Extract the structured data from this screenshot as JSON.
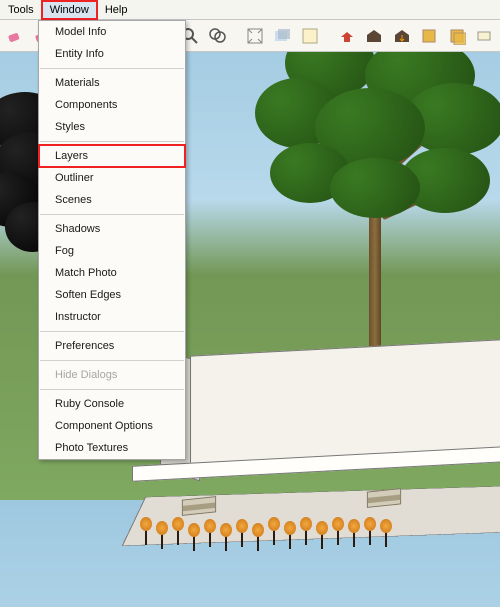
{
  "menubar": {
    "items": [
      "Tools",
      "Window",
      "Help"
    ],
    "highlighted_index": 1
  },
  "toolbar": {
    "tools": [
      "eraser",
      "eraser-alt",
      "select",
      "move",
      "rotate",
      "hand",
      "zoom",
      "prev-view",
      "zoom-extents",
      "face-style",
      "xray",
      "textures",
      "push-pull",
      "warehouse",
      "layers",
      "outliner"
    ]
  },
  "dropdown": {
    "groups": [
      [
        "Model Info",
        "Entity Info"
      ],
      [
        "Materials",
        "Components",
        "Styles"
      ],
      [
        "Layers",
        "Outliner",
        "Scenes"
      ],
      [
        "Shadows",
        "Fog",
        "Match Photo",
        "Soften Edges",
        "Instructor"
      ],
      [
        "Preferences"
      ],
      [
        "Hide Dialogs"
      ],
      [
        "Ruby Console",
        "Component Options",
        "Photo Textures"
      ]
    ],
    "highlighted": "Layers",
    "disabled": [
      "Hide Dialogs"
    ]
  }
}
